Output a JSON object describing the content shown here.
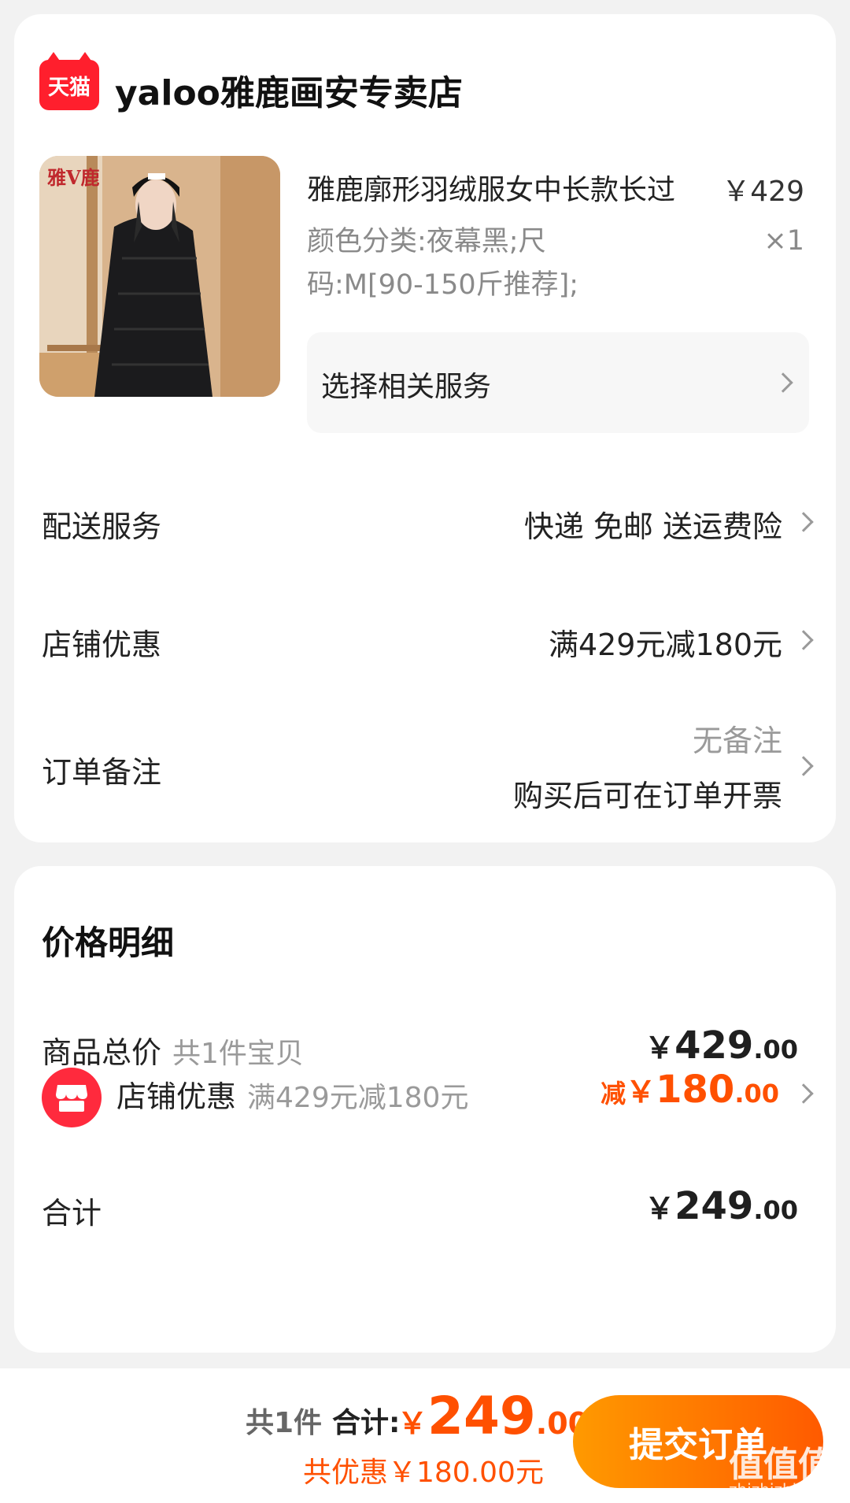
{
  "store": {
    "logo_text": "天猫",
    "name": "yaloo雅鹿画安专卖店"
  },
  "product": {
    "image_brand_text": "雅V鹿",
    "title": "雅鹿廓形羽绒服女中长款长过",
    "price": "￥429",
    "specs": "颜色分类:夜幕黑;尺码:M[90-150斤推荐];",
    "quantity": "×1",
    "service_label": "选择相关服务"
  },
  "rows": {
    "delivery": {
      "label": "配送服务",
      "value": "快递 免邮 送运费险"
    },
    "store_discount": {
      "label": "店铺优惠",
      "value": "满429元减180元"
    },
    "order_note": {
      "label": "订单备注",
      "value_line1": "无备注",
      "value_line2": "购买后可在订单开票"
    }
  },
  "price_detail": {
    "title": "价格明细",
    "goods_total": {
      "label": "商品总价",
      "sub": "共1件宝贝",
      "symbol": "￥",
      "int": "429",
      "dec": ".00"
    },
    "shop_discount": {
      "label": "店铺优惠",
      "sub": "满429元减180元",
      "prefix": "减",
      "symbol": "￥",
      "int": "180",
      "dec": ".00"
    },
    "total": {
      "label": "合计",
      "symbol": "￥",
      "int": "249",
      "dec": ".00"
    }
  },
  "bottom_bar": {
    "count": "共1件",
    "total_label": "合计:",
    "symbol": "￥",
    "int": "249",
    "dec": ".00",
    "discount": "共优惠￥180.00元",
    "submit_label": "提交订单"
  },
  "watermark": {
    "text": "值值值",
    "sub": "zhizhizhi.com"
  },
  "colors": {
    "accent": "#ff5000",
    "tmall_red": "#ff1f2d",
    "button_start": "#ff9a00",
    "button_end": "#ff5a00"
  }
}
